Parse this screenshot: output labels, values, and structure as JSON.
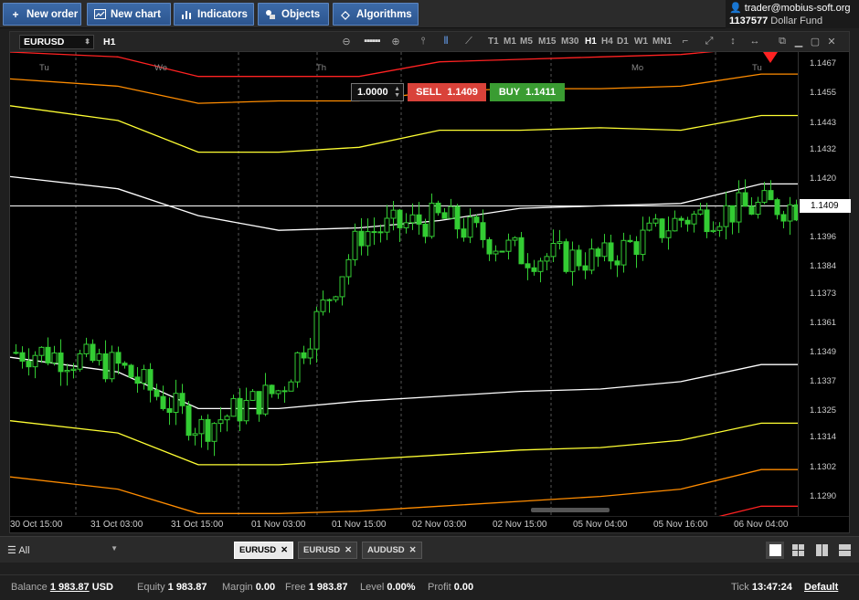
{
  "toolbar": {
    "new_order": "New order",
    "new_chart": "New chart",
    "indicators": "Indicators",
    "objects": "Objects",
    "algorithms": "Algorithms"
  },
  "account": {
    "email": "trader@mobius-soft.org",
    "id": "1137577",
    "fund": "Dollar Fund"
  },
  "chart": {
    "symbol": "EURUSD",
    "timeframe": "H1",
    "timeframes": [
      "T1",
      "M1",
      "M5",
      "M15",
      "M30",
      "H1",
      "H4",
      "D1",
      "W1",
      "MN1"
    ],
    "active_timeframe": "H1",
    "quantity": "1.0000",
    "sell_label": "SELL",
    "sell_price": "1.1409",
    "buy_label": "BUY",
    "buy_price": "1.1411",
    "current_price": "1.1409",
    "day_labels": [
      "Tu",
      "We",
      "Th",
      "Mo",
      "Tu"
    ],
    "y_ticks": [
      "1.1467",
      "1.1455",
      "1.1443",
      "1.1432",
      "1.1420",
      "1.1396",
      "1.1384",
      "1.1373",
      "1.1361",
      "1.1349",
      "1.1337",
      "1.1325",
      "1.1314",
      "1.1302",
      "1.1290"
    ],
    "x_ticks": [
      "30 Oct 15:00",
      "31 Oct 03:00",
      "31 Oct 15:00",
      "01 Nov 03:00",
      "01 Nov 15:00",
      "02 Nov 03:00",
      "02 Nov 15:00",
      "05 Nov 04:00",
      "05 Nov 16:00",
      "06 Nov 04:00"
    ]
  },
  "chart_data": {
    "type": "line",
    "title": "EURUSD H1",
    "x": [
      "30 Oct 15:00",
      "31 Oct 03:00",
      "31 Oct 15:00",
      "01 Nov 03:00",
      "01 Nov 15:00",
      "02 Nov 03:00",
      "02 Nov 15:00",
      "05 Nov 04:00",
      "05 Nov 16:00",
      "06 Nov 04:00"
    ],
    "ylim": [
      1.1282,
      1.1472
    ],
    "series": [
      {
        "name": "",
        "color": "#33cc33",
        "values": [
          1.1349,
          1.1343,
          1.1318,
          1.1334,
          1.1398,
          1.1404,
          1.1389,
          1.1387,
          1.1404,
          1.1409
        ]
      },
      {
        "name": "",
        "color": "#ffffff",
        "values": [
          1.1347,
          1.1341,
          1.1326,
          1.1326,
          1.1329,
          1.1331,
          1.1333,
          1.1334,
          1.1337,
          1.1344
        ]
      },
      {
        "name": "",
        "color": "#ffffff",
        "values": [
          1.1421,
          1.1416,
          1.1405,
          1.1399,
          1.14,
          1.1403,
          1.1408,
          1.1409,
          1.141,
          1.1418
        ]
      },
      {
        "name": "",
        "color": "#ffff33",
        "values": [
          1.1321,
          1.1316,
          1.1303,
          1.1303,
          1.1305,
          1.1307,
          1.1309,
          1.131,
          1.1313,
          1.132
        ]
      },
      {
        "name": "",
        "color": "#ffff33",
        "values": [
          1.145,
          1.1444,
          1.1431,
          1.1431,
          1.1433,
          1.144,
          1.144,
          1.1441,
          1.144,
          1.1446
        ]
      },
      {
        "name": "",
        "color": "#ff8c00",
        "values": [
          1.1298,
          1.1293,
          1.1283,
          1.1283,
          1.1284,
          1.1286,
          1.1288,
          1.129,
          1.1293,
          1.1301
        ]
      },
      {
        "name": "",
        "color": "#ff8c00",
        "values": [
          1.1461,
          1.1458,
          1.1451,
          1.1452,
          1.1452,
          1.1456,
          1.1457,
          1.1457,
          1.1458,
          1.1463
        ]
      },
      {
        "name": "",
        "color": "#ff2222",
        "values": [
          1.128,
          1.1277,
          1.127,
          1.1271,
          1.1271,
          1.1274,
          1.1276,
          1.1277,
          1.1278,
          1.1286
        ]
      },
      {
        "name": "",
        "color": "#ff2222",
        "values": [
          1.1472,
          1.147,
          1.1462,
          1.1462,
          1.1462,
          1.1468,
          1.1469,
          1.147,
          1.1471,
          1.1474
        ]
      }
    ],
    "grid": true
  },
  "tabs": {
    "filter": "All",
    "items": [
      "EURUSD",
      "EURUSD",
      "AUDUSD"
    ]
  },
  "status": {
    "balance_label": "Balance",
    "balance": "1 983.87",
    "currency": "USD",
    "equity_label": "Equity",
    "equity": "1 983.87",
    "margin_label": "Margin",
    "margin": "0.00",
    "free_label": "Free",
    "free": "1 983.87",
    "level_label": "Level",
    "level": "0.00%",
    "profit_label": "Profit",
    "profit": "0.00",
    "tick_label": "Tick",
    "tick": "13:47:24",
    "profile": "Default"
  },
  "colors": {
    "toolbar_btn": "#2c558f",
    "sell": "#d9423a",
    "buy": "#3a9c32",
    "candle": "#33cc33"
  }
}
